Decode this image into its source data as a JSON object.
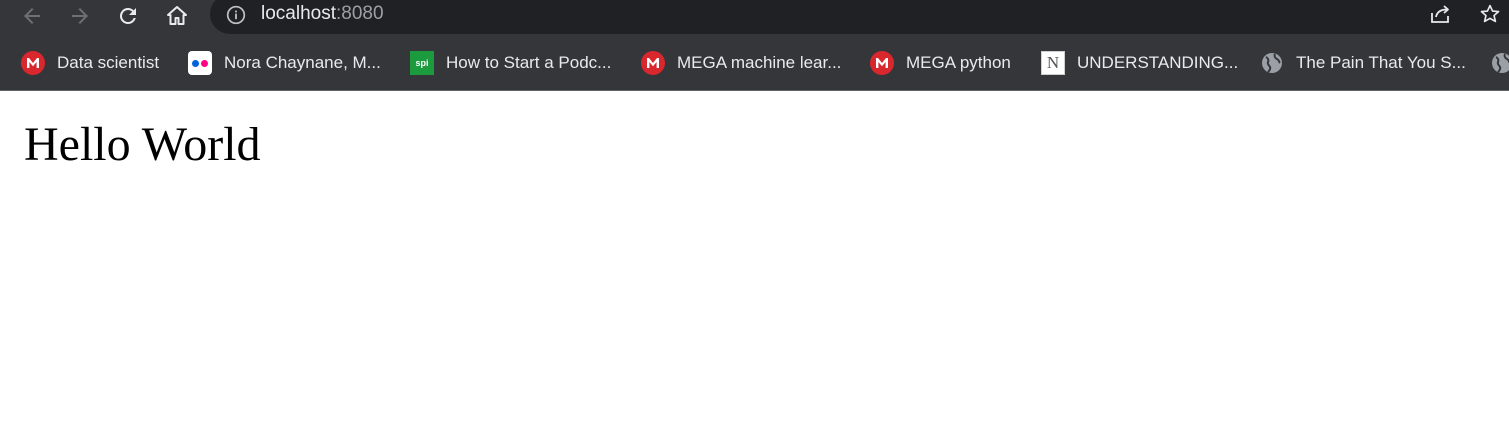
{
  "browser": {
    "address_bar": {
      "host": "localhost",
      "port": ":8080"
    },
    "bookmarks": [
      {
        "label": "Data scientist",
        "icon": "mega-icon"
      },
      {
        "label": "Nora Chaynane, M...",
        "icon": "flickr-icon"
      },
      {
        "label": "How to Start a Podc...",
        "icon": "spi-icon",
        "icon_text": "spi"
      },
      {
        "label": "MEGA machine lear...",
        "icon": "mega-icon"
      },
      {
        "label": "MEGA python",
        "icon": "mega-icon"
      },
      {
        "label": "UNDERSTANDING...",
        "icon": "notion-icon",
        "icon_text": "N"
      },
      {
        "label": "The Pain That You S...",
        "icon": "globe-icon"
      }
    ],
    "colors": {
      "chrome_bg": "#35363a",
      "omnibox_bg": "#202124",
      "text": "#e8eaed",
      "mega_red": "#d9272e",
      "spi_green": "#1b9a3e"
    }
  },
  "page": {
    "heading": "Hello World"
  }
}
